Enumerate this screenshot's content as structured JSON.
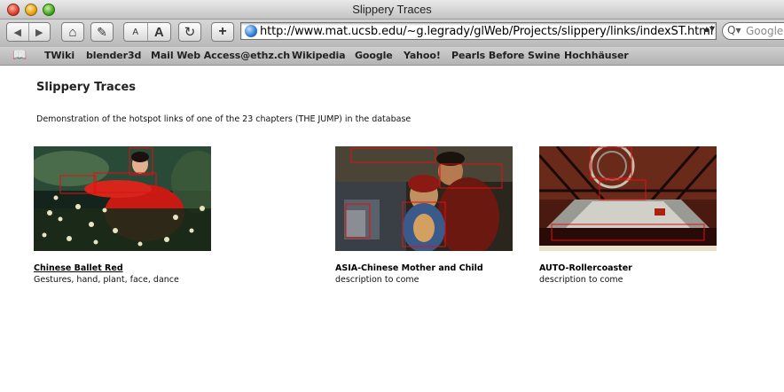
{
  "window": {
    "title": "Slippery Traces"
  },
  "toolbar": {
    "back_icon": "◀",
    "forward_icon": "▶",
    "home_icon": "⌂",
    "edit_icon": "✎",
    "text_smaller": "A",
    "text_bigger": "A",
    "reload_icon": "↻",
    "add_icon": "+",
    "url": "http://www.mat.ucsb.edu/~g.legrady/glWeb/Projects/slippery/links/indexST.html",
    "url_dropdown": "▲▼",
    "search_placeholder": "Google",
    "search_icon": "Q▾"
  },
  "bookmarks": {
    "icon": "📖",
    "items": [
      "TWiki",
      "blender3d",
      "Mail Web Access@ethz.ch",
      "Wikipedia",
      "Google",
      "Yahoo!",
      "Pearls Before Swine",
      "Hochhäuser"
    ]
  },
  "page": {
    "title": "Slippery Traces",
    "intro": "Demonstration of the hotspot links of one of the 23 chapters (THE JUMP) in the database",
    "items": [
      {
        "title": "Chinese Ballet Red",
        "description": "Gestures, hand, plant, face, dance"
      },
      {
        "title": "ASIA-Chinese Mother and Child",
        "description": "description to come"
      },
      {
        "title": "AUTO-Rollercoaster",
        "description": "description to come"
      }
    ]
  },
  "colors": {
    "hotspot": "#e01010",
    "accent_red": "#c8160e"
  }
}
